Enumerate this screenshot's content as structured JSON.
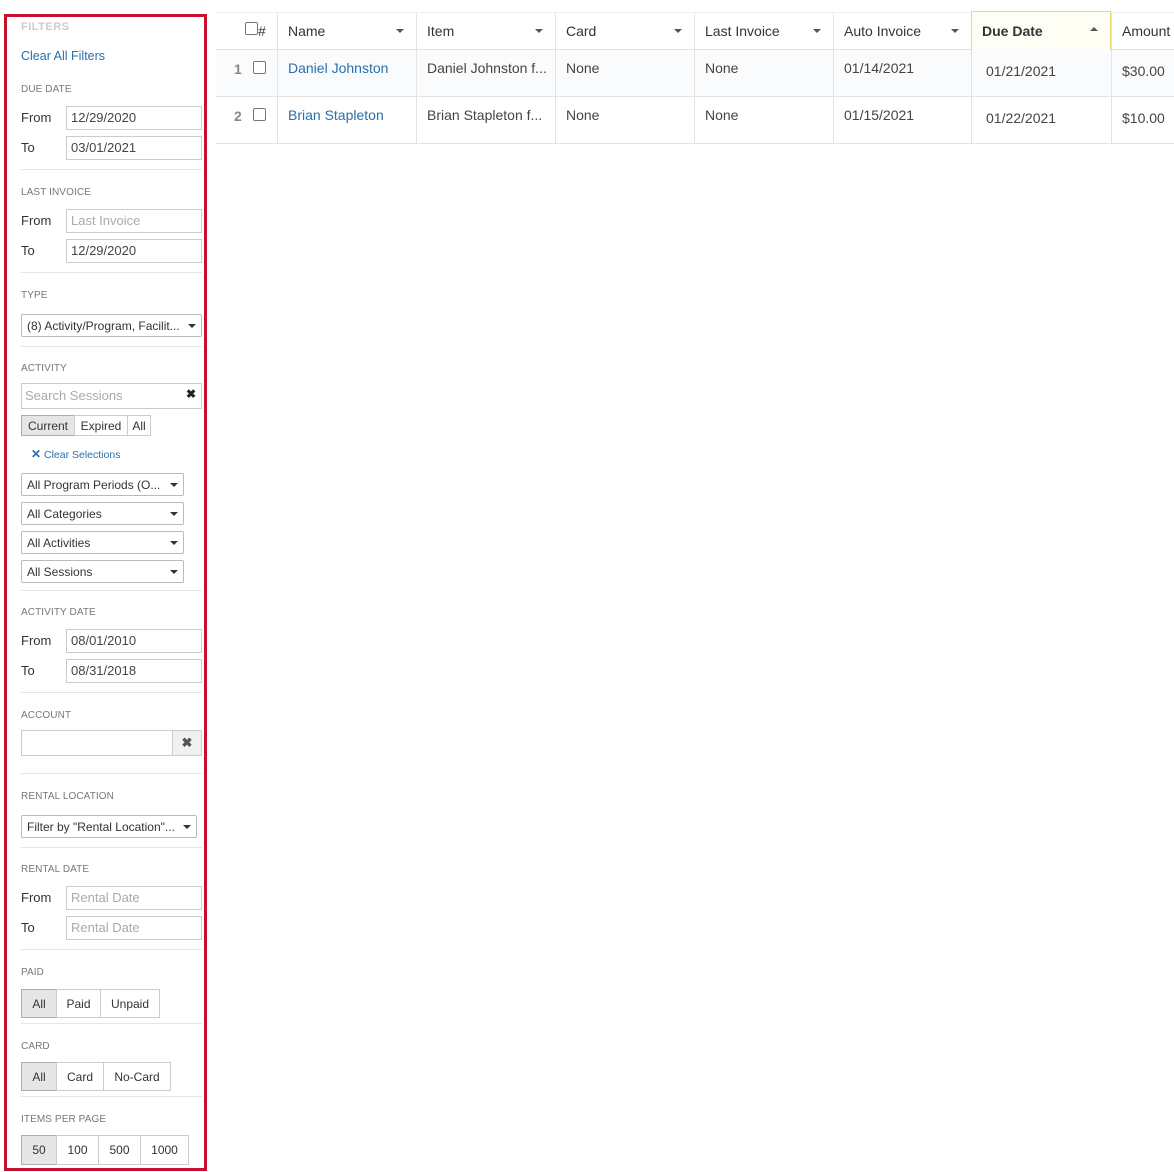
{
  "filters": {
    "title": "FILTERS",
    "clear_all": "Clear All Filters",
    "due_date": {
      "label": "DUE DATE",
      "from_label": "From",
      "from": "12/29/2020",
      "to_label": "To",
      "to": "03/01/2021"
    },
    "last_invoice": {
      "label": "LAST INVOICE",
      "from_label": "From",
      "from_placeholder": "Last Invoice",
      "to_label": "To",
      "to": "12/29/2020"
    },
    "type": {
      "label": "TYPE",
      "selected": "(8) Activity/Program, Facilit..."
    },
    "activity": {
      "label": "ACTIVITY",
      "search_placeholder": "Search Sessions",
      "clear_icon": "close-icon",
      "scope": [
        "Current",
        "Expired",
        "All"
      ],
      "scope_selected": "Current",
      "clear_selections": "Clear Selections",
      "program_periods": "All Program Periods (O...",
      "categories": "All Categories",
      "activities": "All Activities",
      "sessions": "All Sessions"
    },
    "activity_date": {
      "label": "ACTIVITY DATE",
      "from_label": "From",
      "from": "08/01/2010",
      "to_label": "To",
      "to": "08/31/2018"
    },
    "account": {
      "label": "ACCOUNT",
      "value": ""
    },
    "rental_location": {
      "label": "RENTAL LOCATION",
      "selected": "Filter by \"Rental Location\"..."
    },
    "rental_date": {
      "label": "RENTAL DATE",
      "from_label": "From",
      "from_placeholder": "Rental Date",
      "to_label": "To",
      "to_placeholder": "Rental Date"
    },
    "paid": {
      "label": "PAID",
      "options": [
        "All",
        "Paid",
        "Unpaid"
      ],
      "selected": "All"
    },
    "card": {
      "label": "CARD",
      "options": [
        "All",
        "Card",
        "No-Card"
      ],
      "selected": "All"
    },
    "items_per_page": {
      "label": "ITEMS PER PAGE",
      "options": [
        "50",
        "100",
        "500",
        "1000"
      ],
      "selected": "50"
    }
  },
  "table": {
    "header_hash": "#",
    "columns": [
      "Name",
      "Item",
      "Card",
      "Last Invoice",
      "Auto Invoice",
      "Due Date",
      "Amount"
    ],
    "sorted_column": "Due Date",
    "rows": [
      {
        "num": "1",
        "name": "Daniel Johnston",
        "item": "Daniel Johnston f...",
        "card": "None",
        "last_invoice": "None",
        "auto_invoice": "01/14/2021",
        "due_date": "01/21/2021",
        "amount": "$30.00"
      },
      {
        "num": "2",
        "name": "Brian Stapleton",
        "item": "Brian Stapleton f...",
        "card": "None",
        "last_invoice": "None",
        "auto_invoice": "01/15/2021",
        "due_date": "01/22/2021",
        "amount": "$10.00"
      }
    ]
  },
  "colors": {
    "sidebar_border": "#c8102e",
    "link": "#2a6fad",
    "sort_highlight": "#f0d870"
  }
}
